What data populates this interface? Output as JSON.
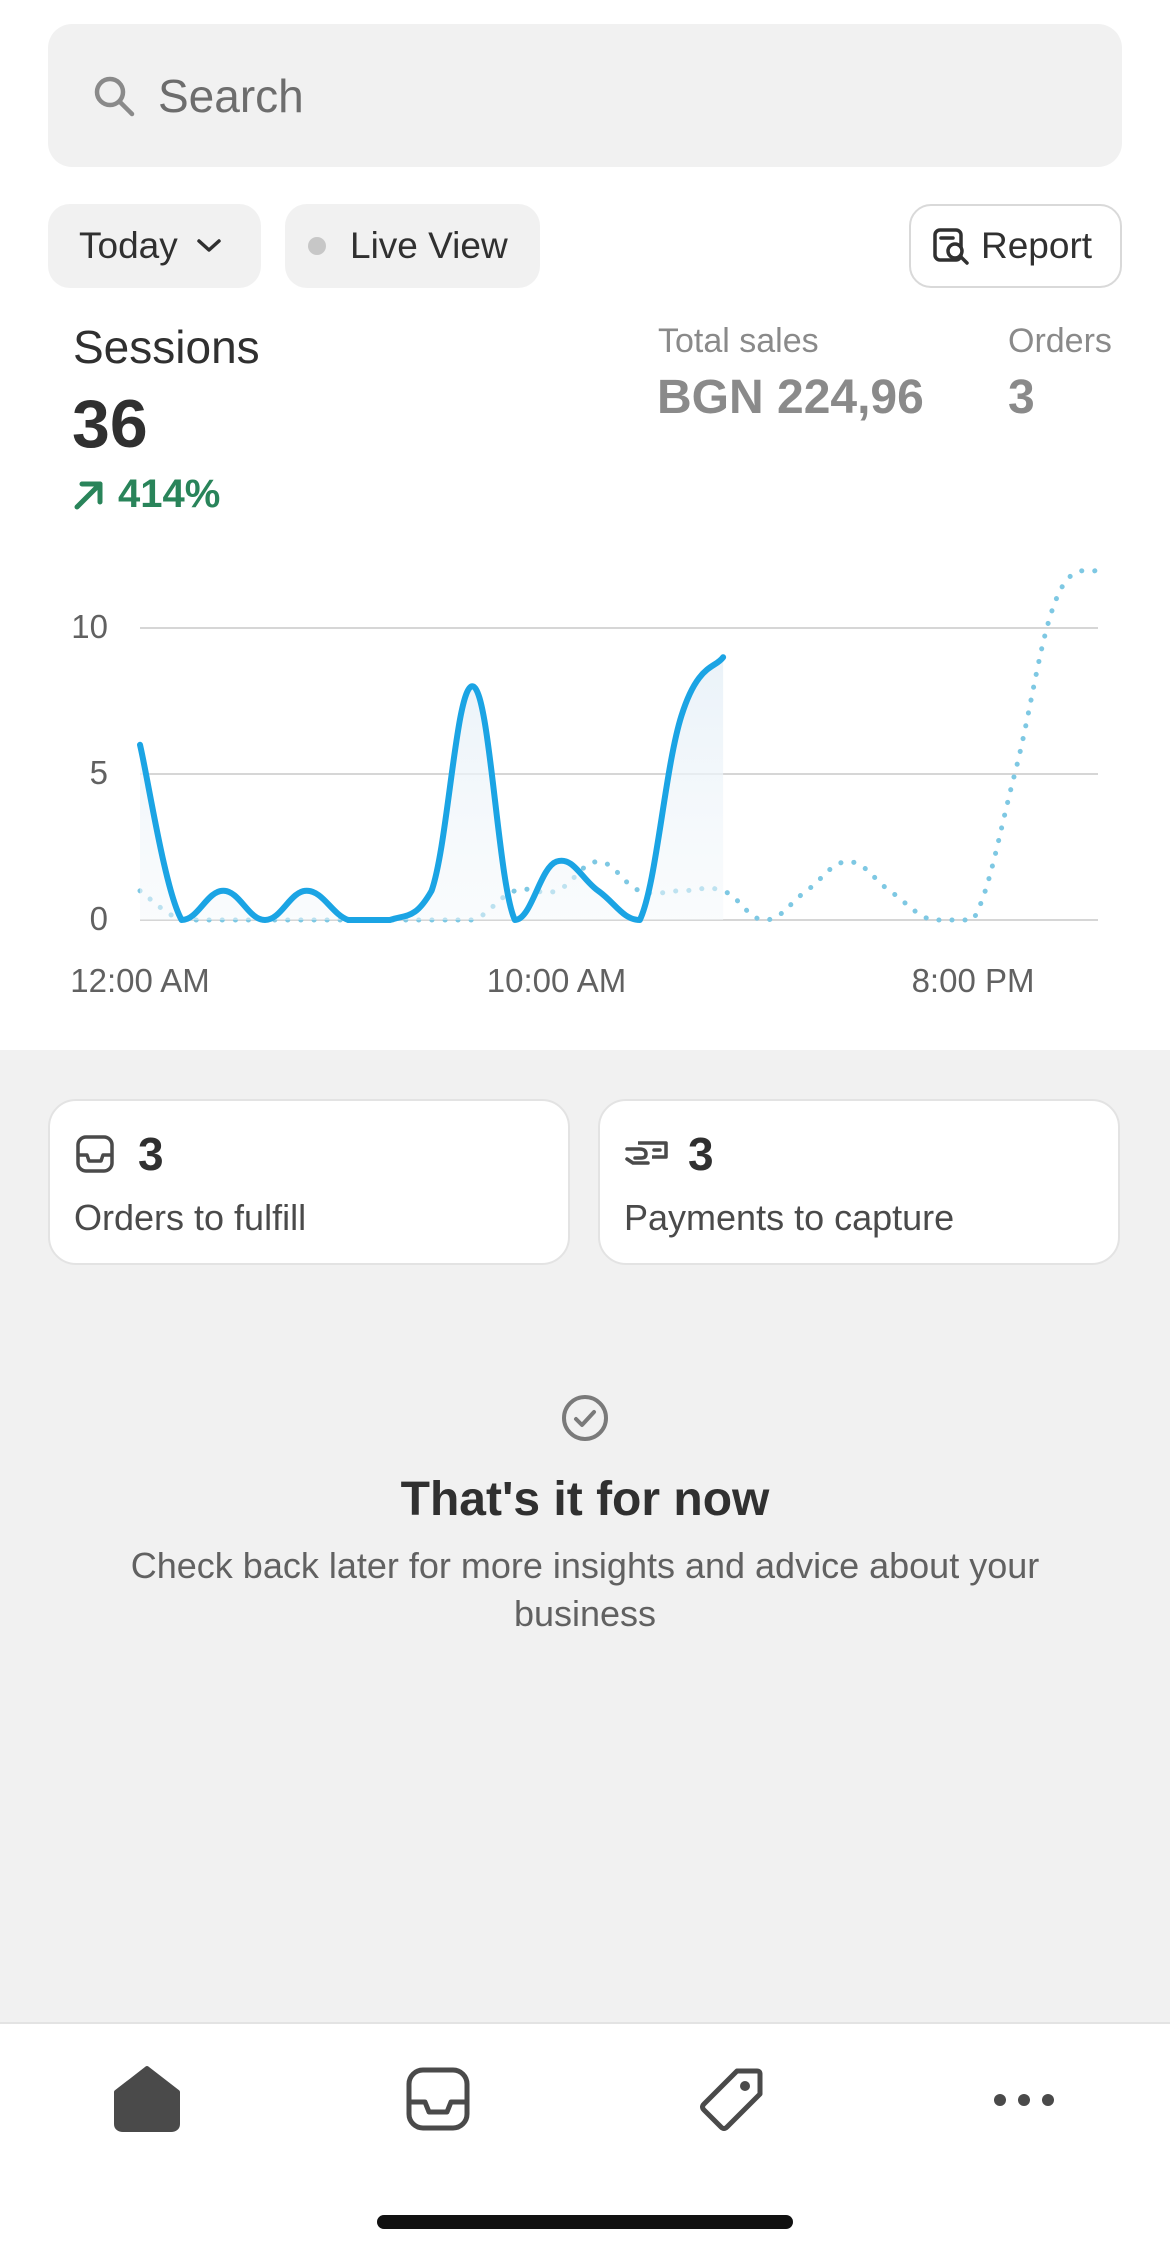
{
  "search": {
    "placeholder": "Search"
  },
  "filters": {
    "date_label": "Today",
    "live_label": "Live View",
    "report_label": "Report"
  },
  "metrics": {
    "sessions_label": "Sessions",
    "sessions_value": "36",
    "sessions_delta": "414%",
    "total_sales_label": "Total sales",
    "total_sales_value": "BGN 224,96",
    "orders_label": "Orders",
    "orders_value": "3"
  },
  "colors": {
    "series": "#1ba4e4",
    "comparison": "#7ec8e3",
    "positive": "#29845a"
  },
  "chart_data": {
    "type": "line",
    "title": "Sessions",
    "ylim": [
      0,
      10
    ],
    "yticks": [
      "0",
      "5",
      "10"
    ],
    "xticks": [
      "12:00 AM",
      "10:00 AM",
      "8:00 PM"
    ],
    "grid": true,
    "x_hours": [
      0,
      1,
      2,
      3,
      4,
      5,
      6,
      7,
      8,
      9,
      10,
      11,
      12,
      13,
      14,
      15,
      16,
      17,
      18,
      19,
      20,
      21,
      22,
      23
    ],
    "series": [
      {
        "values": [
          6,
          0,
          1,
          0,
          1,
          0,
          0,
          1,
          8,
          0,
          2,
          1,
          0,
          7,
          9
        ]
      },
      {
        "values": [
          1,
          0,
          0,
          0,
          0,
          0,
          0,
          0,
          0,
          1,
          1,
          2,
          1,
          1,
          1,
          0,
          1,
          2,
          1,
          0,
          0,
          5,
          11,
          12
        ]
      }
    ]
  },
  "tasks": [
    {
      "icon": "inbox-icon",
      "count": "3",
      "label": "Orders to fulfill"
    },
    {
      "icon": "hand-money-icon",
      "count": "3",
      "label": "Payments to capture"
    }
  ],
  "empty_state": {
    "title": "That's it for now",
    "text": "Check back later for more insights and advice about your business"
  },
  "tabbar": {
    "items": [
      "home-icon",
      "orders-icon",
      "products-icon",
      "more-icon"
    ]
  }
}
